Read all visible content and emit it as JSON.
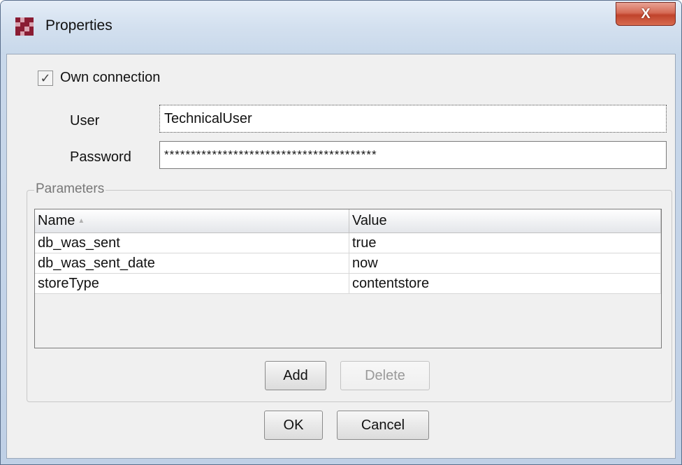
{
  "window": {
    "title": "Properties",
    "close_label": "X"
  },
  "connection": {
    "own_connection_label": "Own connection",
    "own_connection_checked": true,
    "check_glyph": "✓",
    "user_label": "User",
    "user_value": "TechnicalUser",
    "password_label": "Password",
    "password_value": "****************************************"
  },
  "parameters": {
    "group_label": "Parameters",
    "columns": [
      {
        "label": "Name",
        "sort_icon": "▲"
      },
      {
        "label": "Value"
      }
    ],
    "rows": [
      {
        "name": "db_was_sent",
        "value": "true"
      },
      {
        "name": "db_was_sent_date",
        "value": "now"
      },
      {
        "name": "storeType",
        "value": "contentstore"
      }
    ],
    "add_label": "Add",
    "delete_label": "Delete"
  },
  "footer": {
    "ok_label": "OK",
    "cancel_label": "Cancel"
  },
  "colors": {
    "accent_close": "#c0432c",
    "icon_dark": "#8a1c33",
    "icon_light": "#d9a3b1"
  },
  "icons": {
    "app": "app-logo-icon",
    "close": "close-icon",
    "checkbox": "checkmark-icon",
    "sort": "sort-ascending-icon"
  }
}
